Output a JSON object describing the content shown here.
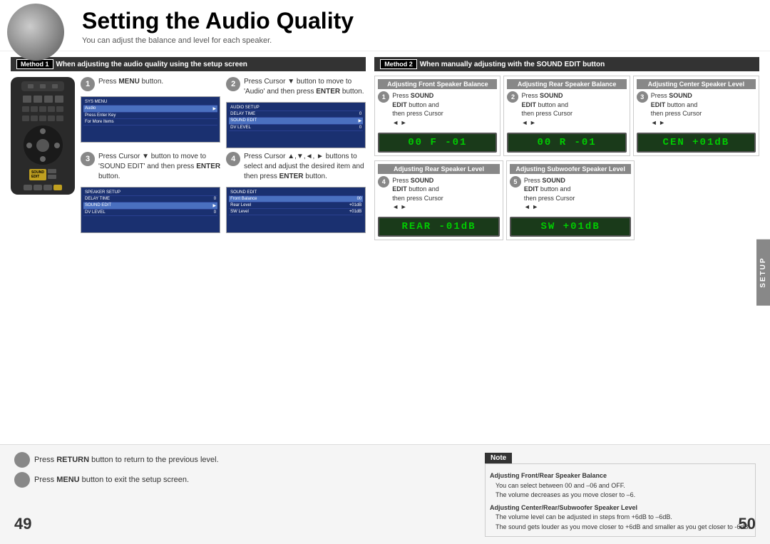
{
  "header": {
    "title": "Setting the Audio Quality",
    "subtitle": "You can adjust the balance and level for each speaker."
  },
  "method1": {
    "badge": "Method 1",
    "label": "When adjusting the audio quality using the setup screen",
    "steps": [
      {
        "number": "1",
        "text": "Press ",
        "bold": "MENU",
        "text2": " button."
      },
      {
        "number": "2",
        "text": "Press Cursor ▼ button to move to 'Audio' and then press ",
        "bold": "ENTER",
        "text2": " button."
      },
      {
        "number": "3",
        "text": "Press Cursor ▼ button to move to 'SOUND EDIT' and then press ",
        "bold": "ENTER",
        "text2": " button."
      },
      {
        "number": "4",
        "text": "Press Cursor ▲,▼,◄, ► buttons to select and adjust the desired item and then press ",
        "bold": "ENTER",
        "text2": " button."
      }
    ]
  },
  "method2": {
    "badge": "Method 2",
    "label": "When manually adjusting with the SOUND EDIT button",
    "sections": [
      {
        "id": "front",
        "header": "Adjusting Front Speaker Balance",
        "step_number": "1",
        "text1": "Press ",
        "bold1": "SOUND",
        "text2": " EDIT button and then press Cursor",
        "arrows": "◄ ►"
      },
      {
        "id": "rear-balance",
        "header": "Adjusting Rear Speaker Balance",
        "step_number": "2",
        "text1": "Press ",
        "bold1": "SOUND",
        "text2": " EDIT button and then press Cursor",
        "arrows": "◄ ►"
      },
      {
        "id": "center",
        "header": "Adjusting Center Speaker Level",
        "step_number": "3",
        "text1": "Press ",
        "bold1": "SOUND",
        "text2": " EDIT button and then press Cursor",
        "arrows": "◄ ►"
      },
      {
        "id": "rear-level",
        "header": "Adjusting Rear Speaker Level",
        "step_number": "4",
        "text1": "Press ",
        "bold1": "SOUND",
        "text2": " EDIT button and then press Cursor",
        "arrows": "◄ ►"
      },
      {
        "id": "subwoofer",
        "header": "Adjusting Subwoofer Speaker Level",
        "step_number": "5",
        "text1": "Press ",
        "bold1": "SOUND",
        "text2": " EDIT button and then press Cursor",
        "arrows": "◄ ►"
      }
    ],
    "displays": [
      "00 F -01",
      "00 R -01",
      "CEN +01dB",
      "REAR -01dB",
      "SW  +01dB"
    ]
  },
  "bottom": {
    "return_text": "Press RETURN button to return to the previous level.",
    "return_bold": "RETURN",
    "menu_text": "Press MENU button to exit the setup screen.",
    "menu_bold": "MENU",
    "note": {
      "title": "Note",
      "section1_title": "Adjusting Front/Rear Speaker Balance",
      "section1_bullets": [
        "You can select between 00 and –06 and OFF.",
        "The volume decreases as you move closer to –6."
      ],
      "section2_title": "Adjusting Center/Rear/Subwoofer Speaker Level",
      "section2_bullets": [
        "The volume level can be adjusted in steps from +6dB to –6dB.",
        "The sound gets louder as you move closer to +6dB and smaller as you get closer to -6dB."
      ]
    }
  },
  "page_numbers": {
    "left": "49",
    "right": "50"
  },
  "setup_tab": "SETUP"
}
